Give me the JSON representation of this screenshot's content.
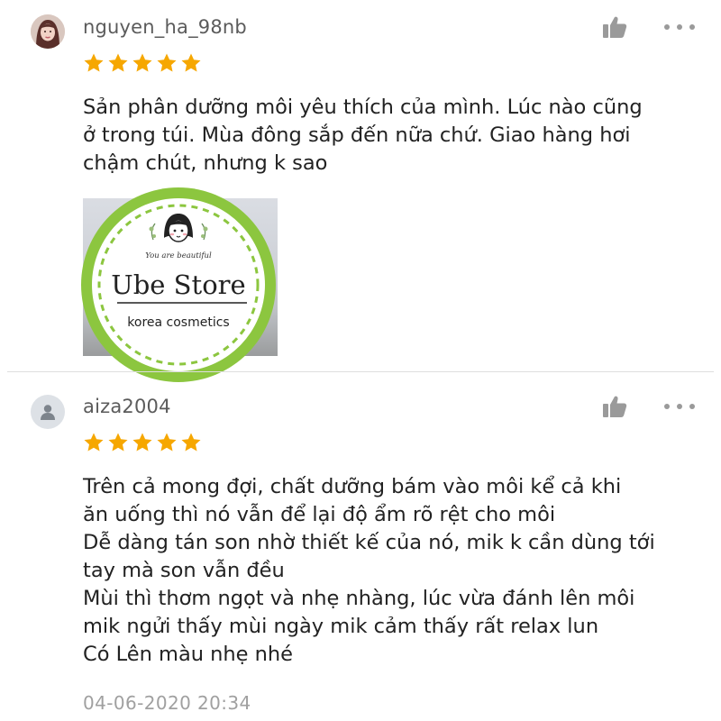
{
  "reviews": [
    {
      "username": "nguyen_ha_98nb",
      "rating": 5,
      "rating_max": 5,
      "avatar": "user-photo",
      "text": "Sản phân dưỡng môi yêu thích của mình. Lúc nào cũng\nở trong túi. Mùa đông sắp đến nữa chứ. Giao hàng hơi\nchậm chút, nhưng k sao",
      "image": {
        "seal_tagline": "You are beautiful",
        "store_name": "Ube Store",
        "store_subtitle": "korea cosmetics"
      }
    },
    {
      "username": "aiza2004",
      "rating": 5,
      "rating_max": 5,
      "avatar": "default-user-icon",
      "text": "Trên cả mong đợi, chất dưỡng bám vào môi kể cả khi\năn uống thì nó vẫn để lại độ ẩm rõ rệt cho môi\nDễ dàng tán son nhờ thiết kế của nó, mik k cần dùng tới\ntay mà son vẫn đều\nMùi thì thơm ngọt và nhẹ nhàng, lúc vừa đánh lên môi\nmik ngửi thấy mùi ngày mik cảm thấy rất relax lun\nCó Lên màu nhẹ nhé",
      "timestamp": "04-06-2020 20:34"
    }
  ],
  "icons": {
    "like": "thumbs-up-icon",
    "more": "more-options-icon",
    "star": "star-icon"
  },
  "colors": {
    "star": "#f6a700",
    "seal_ring": "#8cc63f",
    "username": "#5b5b5b",
    "icon": "#9a9a9a",
    "timestamp": "#a0a0a0"
  }
}
